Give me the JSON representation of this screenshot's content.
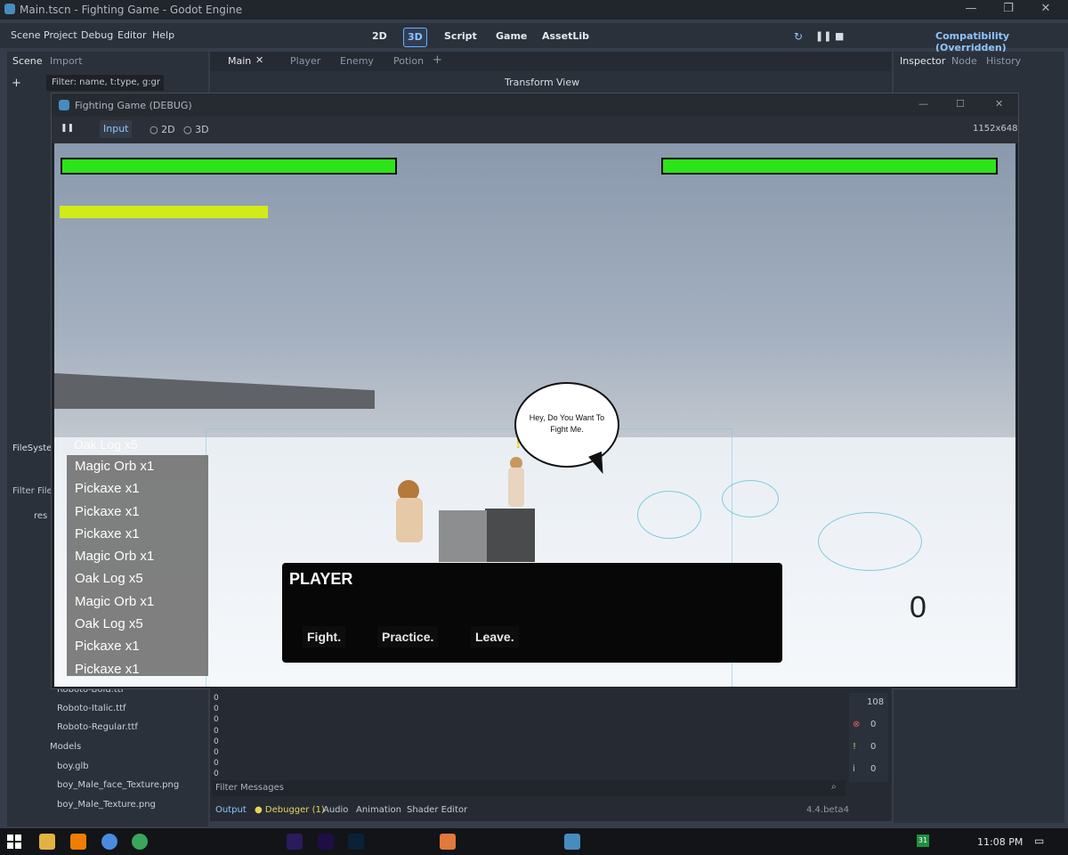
{
  "window": {
    "title": "Main.tscn - Fighting Game - Godot Engine"
  },
  "menu": [
    "Scene",
    "Project",
    "Debug",
    "Editor",
    "Help"
  ],
  "modes": [
    "2D",
    "3D",
    "Script",
    "Game",
    "AssetLib"
  ],
  "renderer": "Compatibility (Overridden)",
  "left_dock": {
    "tabs": [
      "Scene",
      "Import"
    ],
    "filter_placeholder": "Filter: name, t:type, g:gr",
    "filesystem_label": "FileSystem",
    "filter_files": "Filter Files",
    "res_label": "res",
    "files": [
      "Roboto-Bold.ttf",
      "Roboto-Italic.ttf",
      "Roboto-Regular.ttf",
      "Models",
      "boy.glb",
      "boy_Male_face_Texture.png",
      "boy_Male_Texture.png"
    ]
  },
  "scene_tabs": [
    "Main",
    "Player",
    "Enemy",
    "Potion"
  ],
  "toolbar_3d": {
    "transform": "Transform",
    "view": "View"
  },
  "inspector": {
    "tabs": [
      "Inspector",
      "Node",
      "History"
    ]
  },
  "game_window": {
    "title": "Fighting Game (DEBUG)",
    "toolbar": {
      "input": "Input",
      "two_d": "2D",
      "three_d": "3D",
      "resolution": "1152x648"
    },
    "player_health": 1.0,
    "enemy_health": 1.0,
    "stamina": 0.62,
    "speech_bubble": "Hey, Do You Want To Fight Me.",
    "inventory_overflow": "Oak Log x5",
    "inventory": [
      "Magic Orb x1",
      "Pickaxe x1",
      "Pickaxe x1",
      "Pickaxe x1",
      "Magic Orb x1",
      "Oak Log x5",
      "Magic Orb x1",
      "Oak Log x5",
      "Pickaxe x1",
      "Pickaxe x1"
    ],
    "dialog": {
      "speaker": "PLAYER",
      "options": [
        "Fight.",
        "Practice.",
        "Leave."
      ]
    },
    "score": "0"
  },
  "bottom_panel": {
    "filter_messages": "Filter Messages",
    "tabs": [
      "Output",
      "Debugger (1)",
      "Audio",
      "Animation",
      "Shader Editor"
    ],
    "version": "4.4.beta4",
    "counts": {
      "messages": "108",
      "errors": "0",
      "warnings": "0",
      "info": "0"
    },
    "log_lines": [
      "0",
      "0",
      "0",
      "0",
      "0",
      "0",
      "0",
      "0"
    ]
  },
  "taskbar": {
    "time": "11:08 PM",
    "badge": "31"
  }
}
